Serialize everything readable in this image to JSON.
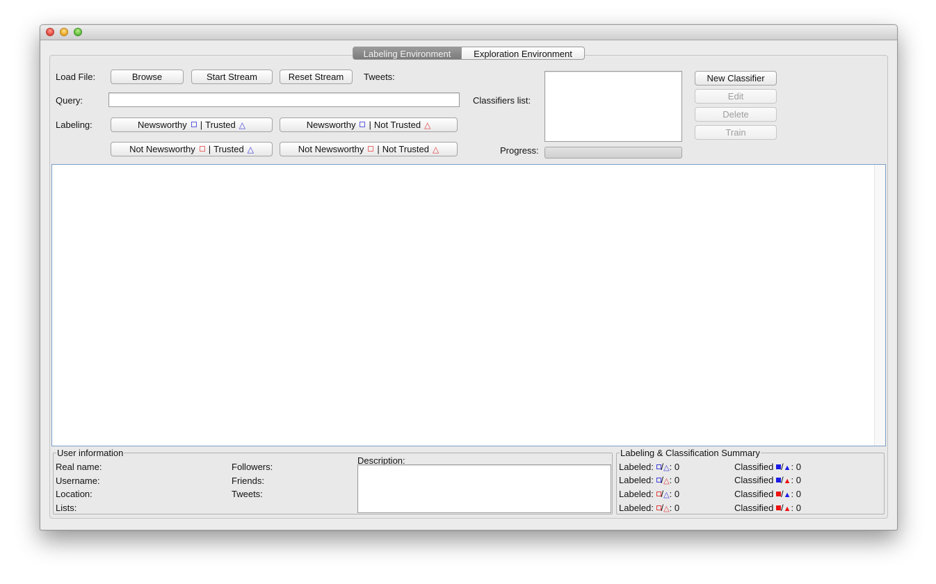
{
  "tabs": {
    "labeling": "Labeling Environment",
    "exploration": "Exploration Environment"
  },
  "controls": {
    "load_file_label": "Load File:",
    "browse": "Browse",
    "start_stream": "Start Stream",
    "reset_stream": "Reset Stream",
    "tweets_label": "Tweets:",
    "query_label": "Query:",
    "query_value": "",
    "labeling_label": "Labeling:",
    "btn_nw_trusted": {
      "a": "Newsworthy",
      "b": "Trusted"
    },
    "btn_nw_not_trusted": {
      "a": "Newsworthy",
      "b": "Not Trusted"
    },
    "btn_not_nw_trusted": {
      "a": "Not Newsworthy",
      "b": "Trusted"
    },
    "btn_not_nw_not_trusted": {
      "a": "Not Newsworthy",
      "b": "Not Trusted"
    },
    "sep": "|",
    "tri_outline": "△",
    "tri_filled": "▲"
  },
  "classifiers": {
    "list_label": "Classifiers list:",
    "progress_label": "Progress:",
    "progress": 0,
    "new": "New Classifier",
    "edit": "Edit",
    "delete": "Delete",
    "train": "Train"
  },
  "user_info": {
    "legend": "User information",
    "real_name": "Real name:",
    "username": "Username:",
    "location": "Location:",
    "lists": "Lists:",
    "followers": "Followers:",
    "friends": "Friends:",
    "tweets": "Tweets:",
    "description": "Description:"
  },
  "summary": {
    "legend": "Labeling & Classification Summary",
    "labeled": "Labeled:",
    "classified": "Classified",
    "slash": "/",
    "rows": [
      {
        "sq": "blue",
        "tri": "blue",
        "labeled_count": ": 0",
        "classified_count": ": 0"
      },
      {
        "sq": "blue",
        "tri": "red",
        "labeled_count": ": 0",
        "classified_count": ": 0"
      },
      {
        "sq": "red",
        "tri": "blue",
        "labeled_count": ": 0",
        "classified_count": ": 0"
      },
      {
        "sq": "red",
        "tri": "red",
        "labeled_count": ": 0",
        "classified_count": ": 0"
      }
    ]
  },
  "colors": {
    "blue": "#3b3bdb",
    "red": "#e03a3a",
    "accent_border": "#7a9ec6"
  }
}
